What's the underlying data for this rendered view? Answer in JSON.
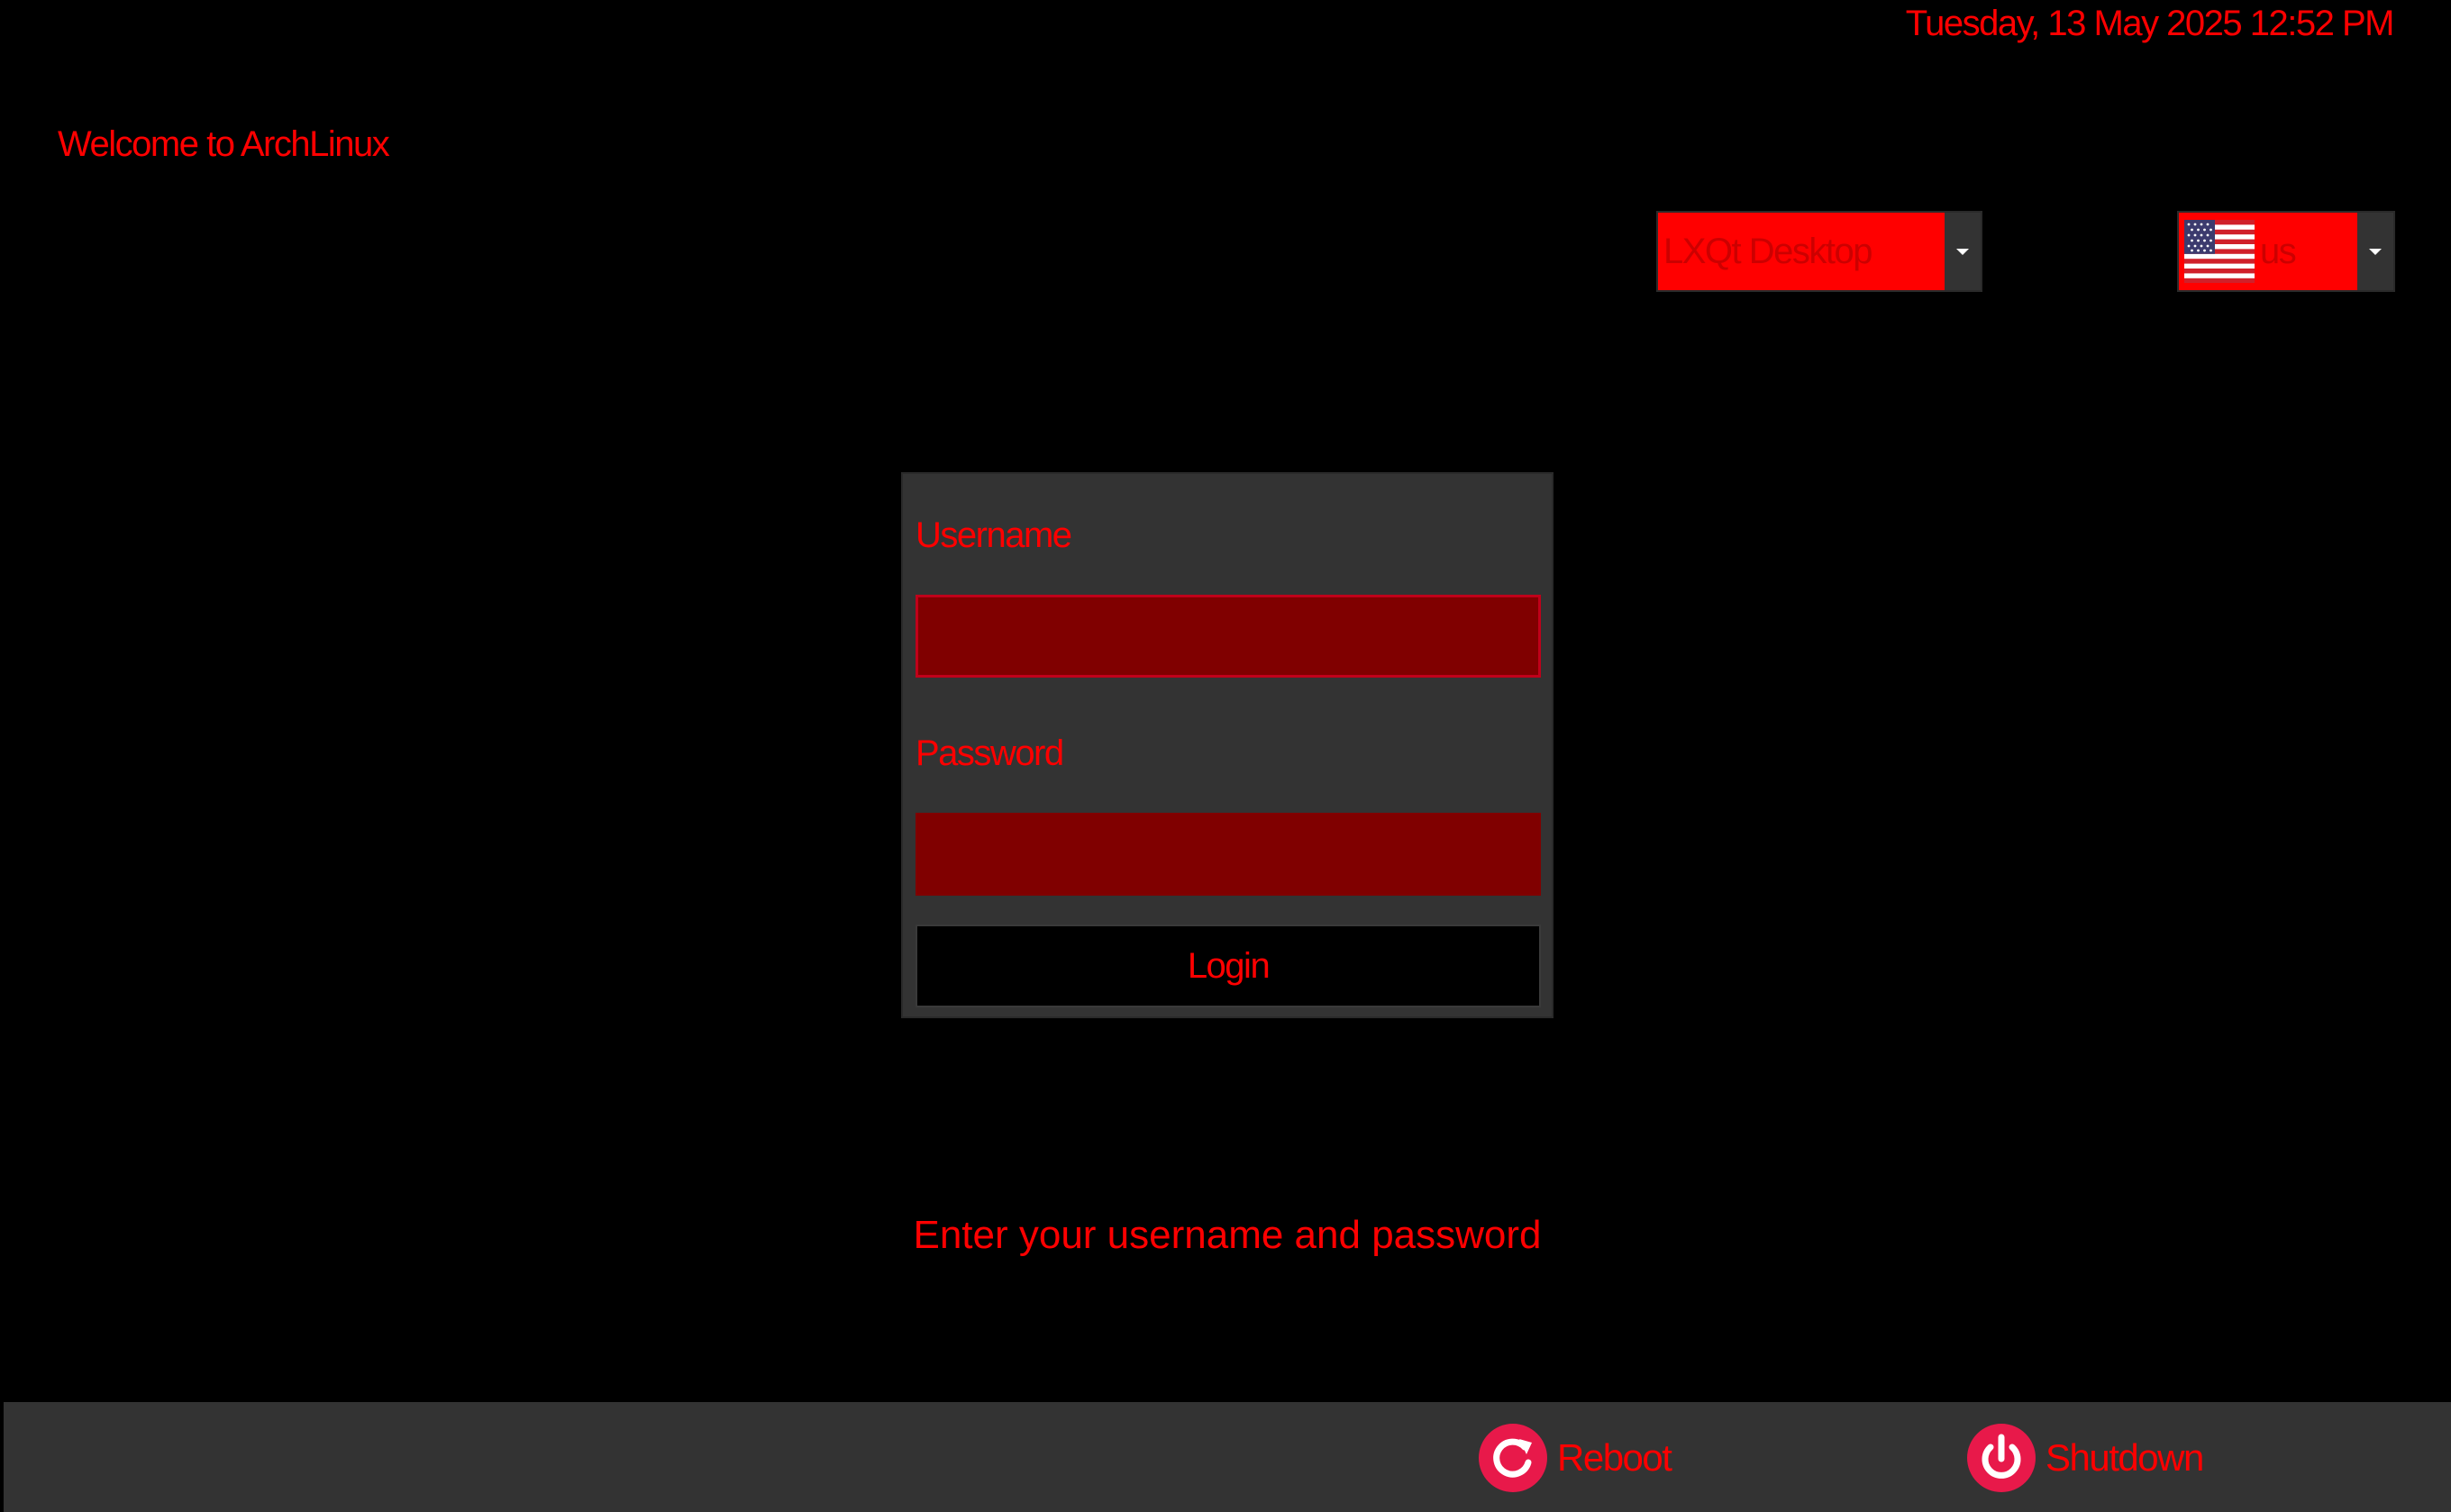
{
  "header": {
    "datetime": "Tuesday, 13 May 2025  12:52 PM",
    "welcome": "Welcome to ArchLinux"
  },
  "session": {
    "selected": "LXQt Desktop",
    "icon": "chevron-down-icon"
  },
  "keyboard_layout": {
    "selected": "us",
    "flag_icon": "us-flag-icon"
  },
  "login": {
    "username_label": "Username",
    "username_value": "",
    "password_label": "Password",
    "password_value": "",
    "login_button": "Login"
  },
  "message": "Enter your username and password",
  "bottom_bar": {
    "reboot_label": "Reboot",
    "reboot_icon": "reboot-icon",
    "shutdown_label": "Shutdown",
    "shutdown_icon": "power-icon"
  },
  "colors": {
    "background": "#000000",
    "accent": "#ff0000",
    "panel": "#333333",
    "input_fill": "#800000"
  }
}
